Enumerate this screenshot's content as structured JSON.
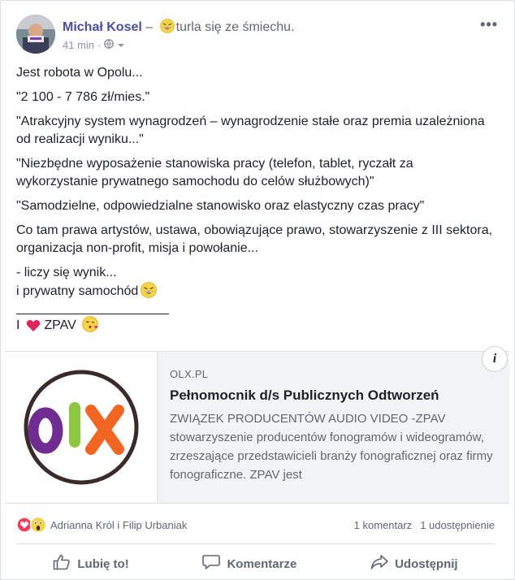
{
  "post": {
    "author": "Michał Kosel",
    "dash": "–",
    "feeling": "turla się ze śmiechu.",
    "time": "41 min",
    "privacy_icon": "globe-icon",
    "more_icon": "•••"
  },
  "body": {
    "lines": [
      "Jest robota w Opolu...",
      "\"2 100 - 7 786 zł/mies.\"",
      "\"Atrakcyjny system wynagrodzeń – wynagrodzenie stałe oraz premia uzależniona od realizacji wyniku...\"",
      "\"Niezbędne wyposażenie stanowiska pracy (telefon, tablet, ryczałt za wykorzystanie prywatnego samochodu do celów służbowych)\"",
      "\"Samodzielne, odpowiedzialne stanowisko oraz elastyczny czas pracy\"",
      "Co tam prawa artystów, ustawa, obowiązujące prawo, stowarzyszenie z III sektora, organizacja non-profit, misja i powołanie..."
    ],
    "line7a": "- liczy się wynik...",
    "line7b": "i prywatny samochód",
    "sig_pre": "I",
    "sig_post": "ZPAV"
  },
  "link": {
    "domain": "OLX.PL",
    "title": "Pełnomocnik d/s Publicznych Odtworzeń",
    "description": "ZWIĄZEK PRODUCENTÓW AUDIO VIDEO -ZPAV stowarzyszenie producentów fonogramów i wideogramów, zrzeszające przedstawicieli branży fonograficznej oraz firmy fonograficzne. ZPAV jest",
    "info": "i",
    "logo_text": "OLX"
  },
  "stats": {
    "reactors": "Adrianna Król i Filip Urbaniak",
    "comments": "1 komentarz",
    "shares": "1 udostępnienie"
  },
  "actions": {
    "like": "Lubię to!",
    "comment": "Komentarze",
    "share": "Udostępnij"
  },
  "colors": {
    "author": "#4b4f9c",
    "olx_purple": "#6f2c91",
    "olx_green": "#8dc63f",
    "olx_orange": "#f26522",
    "heart": "#e0245e"
  }
}
